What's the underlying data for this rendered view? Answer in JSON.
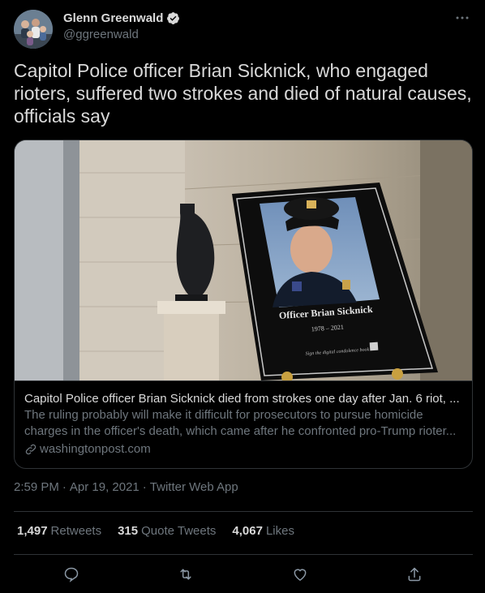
{
  "author": {
    "name": "Glenn Greenwald",
    "handle": "@ggreenwald",
    "avatar_icon": "avatar-photo"
  },
  "tweet": {
    "text": "Capitol Police officer Brian Sicknick, who engaged rioters, suffered two strokes and died of natural causes, officials say"
  },
  "card": {
    "image": {
      "plaque_name": "Officer Brian Sicknick",
      "plaque_years": "1978 – 2021",
      "plaque_caption": "Sign the digital condolence book"
    },
    "title": "Capitol Police officer Brian Sicknick died from strokes one day after Jan. 6 riot, ...",
    "description": "The ruling probably will make it difficult for prosecutors to pursue homicide charges in the officer's death, which came after he confronted pro-Trump rioter...",
    "domain": "washingtonpost.com"
  },
  "meta": {
    "time": "2:59 PM",
    "sep1": "·",
    "date": "Apr 19, 2021",
    "sep2": "·",
    "source": "Twitter Web App"
  },
  "stats": {
    "retweets_count": "1,497",
    "retweets_label": "Retweets",
    "quotes_count": "315",
    "quotes_label": "Quote Tweets",
    "likes_count": "4,067",
    "likes_label": "Likes"
  },
  "colors": {
    "background": "#000000",
    "text": "#d9d9d9",
    "muted": "#6e767d",
    "border": "#2f3336"
  }
}
